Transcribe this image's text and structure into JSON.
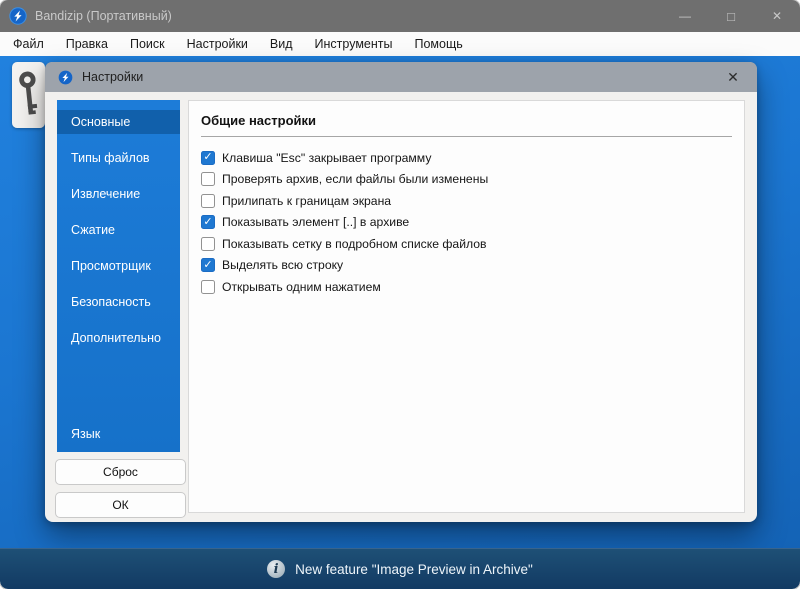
{
  "colors": {
    "titlebar": "#6f6f6f",
    "menubar": "#fbfbfb",
    "client_blue": "#1b76d1",
    "statusbar": "#123a63",
    "dialog_frame": "#f2f1ef",
    "dialog_titlebar": "#9da3ab",
    "sidebar_blue": "#1671c9",
    "sidebar_selected": "#1160ab",
    "checkbox_checked": "#1f78d1"
  },
  "window": {
    "title": "Bandizip (Портативный)",
    "controls": {
      "minimize": "—",
      "maximize": "□",
      "close": "✕"
    }
  },
  "menu": {
    "items": [
      "Файл",
      "Правка",
      "Поиск",
      "Настройки",
      "Вид",
      "Инструменты",
      "Помощь"
    ]
  },
  "dialog": {
    "title": "Настройки",
    "close_glyph": "✕",
    "sidebar_items": [
      {
        "label": "Основные",
        "selected": true
      },
      {
        "label": "Типы файлов"
      },
      {
        "label": "Извлечение"
      },
      {
        "label": "Сжатие"
      },
      {
        "label": "Просмотрщик"
      },
      {
        "label": "Безопасность"
      },
      {
        "label": "Дополнительно"
      },
      {
        "label": "Язык",
        "bottom": true
      }
    ],
    "buttons": {
      "reset": "Сброс",
      "ok": "ОК"
    },
    "content": {
      "heading": "Общие настройки",
      "checkboxes": [
        {
          "label": "Клавиша \"Esc\" закрывает программу",
          "checked": true
        },
        {
          "label": "Проверять архив, если файлы были изменены",
          "checked": false
        },
        {
          "label": "Прилипать к границам экрана",
          "checked": false
        },
        {
          "label": "Показывать элемент [..] в архиве",
          "checked": true
        },
        {
          "label": "Показывать сетку в подробном списке файлов",
          "checked": false
        },
        {
          "label": "Выделять всю строку",
          "checked": true
        },
        {
          "label": "Открывать одним нажатием",
          "checked": false
        }
      ]
    }
  },
  "statusbar": {
    "icon_glyph": "i",
    "text": "New feature \"Image Preview in Archive\""
  }
}
